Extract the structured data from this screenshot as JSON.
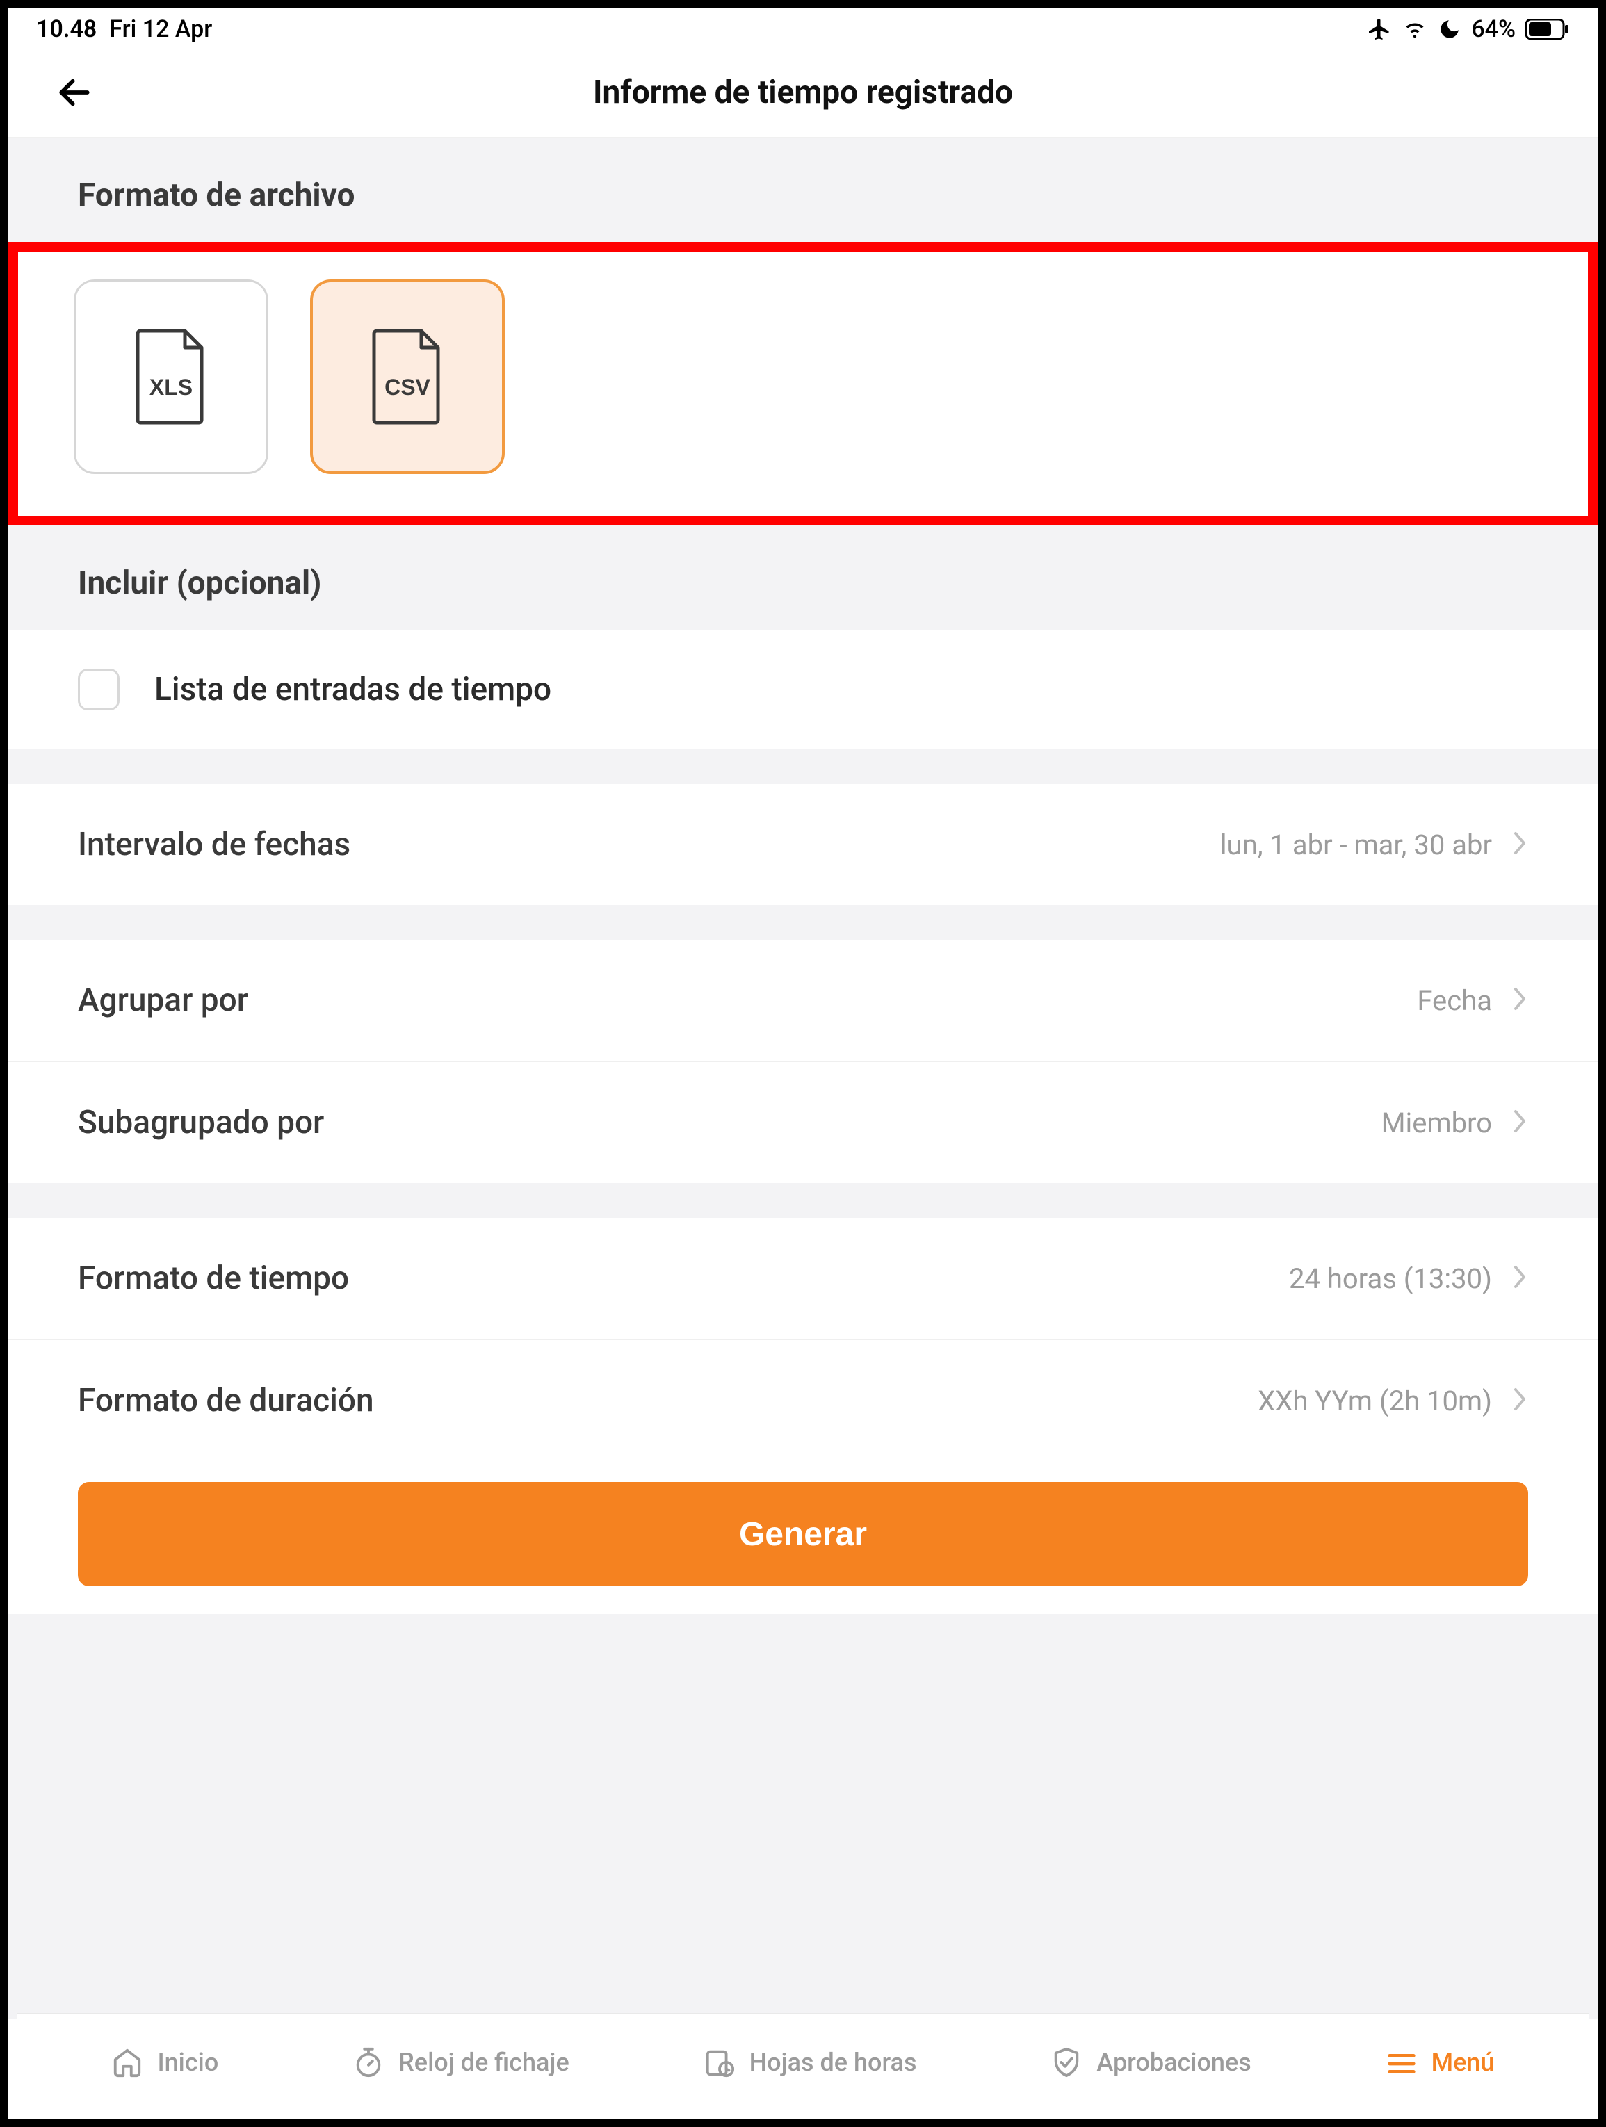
{
  "status": {
    "time": "10.48",
    "date": "Fri 12 Apr",
    "battery_pct": "64%"
  },
  "header": {
    "title": "Informe de tiempo registrado"
  },
  "sections": {
    "file_format_label": "Formato de archivo",
    "include_label": "Incluir (opcional)"
  },
  "file_formats": {
    "xls": "XLS",
    "csv": "CSV"
  },
  "include": {
    "time_entries_list": "Lista de entradas de tiempo"
  },
  "rows": {
    "date_range": {
      "label": "Intervalo de fechas",
      "value": "lun, 1 abr - mar, 30 abr"
    },
    "group_by": {
      "label": "Agrupar por",
      "value": "Fecha"
    },
    "subgroup_by": {
      "label": "Subagrupado por",
      "value": "Miembro"
    },
    "time_format": {
      "label": "Formato de tiempo",
      "value": "24 horas (13:30)"
    },
    "dur_format": {
      "label": "Formato de duración",
      "value": "XXh YYm (2h 10m)"
    }
  },
  "generate_label": "Generar",
  "tabs": {
    "home": "Inicio",
    "clock": "Reloj de fichaje",
    "timesheets": "Hojas de horas",
    "approvals": "Aprobaciones",
    "menu": "Menú"
  }
}
